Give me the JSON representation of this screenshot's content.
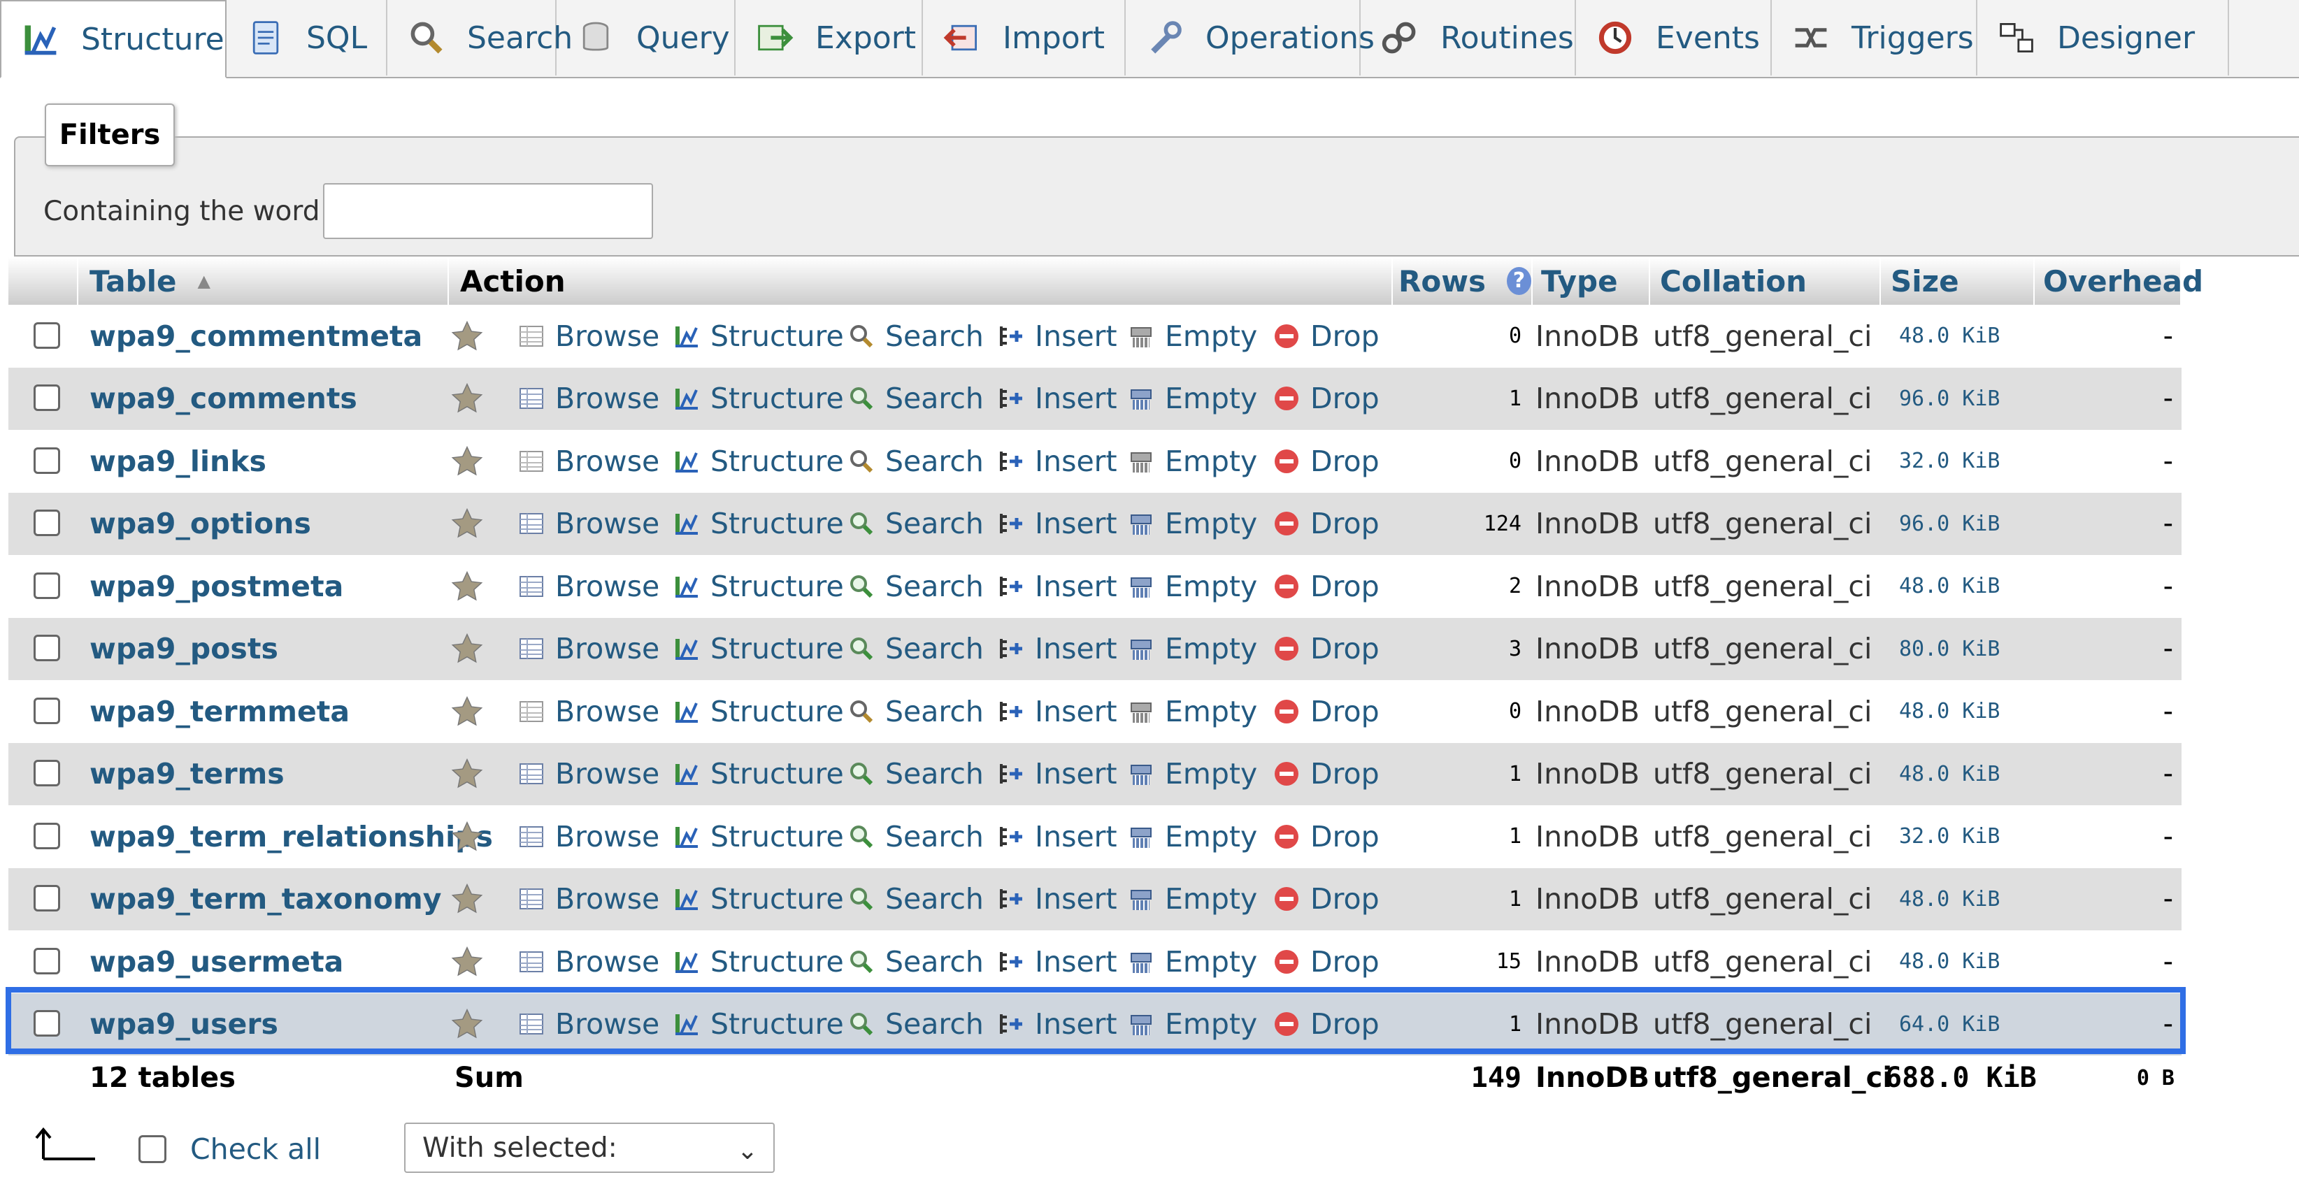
{
  "tabs": [
    {
      "label": "Structure",
      "icon": "structure-icon",
      "active": true
    },
    {
      "label": "SQL",
      "icon": "sql-icon"
    },
    {
      "label": "Search",
      "icon": "search-icon"
    },
    {
      "label": "Query",
      "icon": "query-icon"
    },
    {
      "label": "Export",
      "icon": "export-icon"
    },
    {
      "label": "Import",
      "icon": "import-icon"
    },
    {
      "label": "Operations",
      "icon": "wrench-icon"
    },
    {
      "label": "Routines",
      "icon": "routines-icon"
    },
    {
      "label": "Events",
      "icon": "clock-icon"
    },
    {
      "label": "Triggers",
      "icon": "triggers-icon"
    },
    {
      "label": "Designer",
      "icon": "designer-icon"
    }
  ],
  "filters": {
    "legend": "Filters",
    "label": "Containing the word:",
    "value": "",
    "placeholder": ""
  },
  "table": {
    "headers": {
      "table": "Table",
      "action": "Action",
      "rows": "Rows",
      "type": "Type",
      "collation": "Collation",
      "size": "Size",
      "overhead": "Overhead"
    },
    "sort_indicator": "▲",
    "actions": {
      "browse": "Browse",
      "structure": "Structure",
      "search": "Search",
      "insert": "Insert",
      "empty": "Empty",
      "drop": "Drop"
    },
    "rows": [
      {
        "name": "wpa9_commentmeta",
        "rows": "0",
        "type": "InnoDB",
        "collation": "utf8_general_ci",
        "size": "48.0 KiB",
        "overhead": "-"
      },
      {
        "name": "wpa9_comments",
        "rows": "1",
        "type": "InnoDB",
        "collation": "utf8_general_ci",
        "size": "96.0 KiB",
        "overhead": "-"
      },
      {
        "name": "wpa9_links",
        "rows": "0",
        "type": "InnoDB",
        "collation": "utf8_general_ci",
        "size": "32.0 KiB",
        "overhead": "-"
      },
      {
        "name": "wpa9_options",
        "rows": "124",
        "type": "InnoDB",
        "collation": "utf8_general_ci",
        "size": "96.0 KiB",
        "overhead": "-"
      },
      {
        "name": "wpa9_postmeta",
        "rows": "2",
        "type": "InnoDB",
        "collation": "utf8_general_ci",
        "size": "48.0 KiB",
        "overhead": "-"
      },
      {
        "name": "wpa9_posts",
        "rows": "3",
        "type": "InnoDB",
        "collation": "utf8_general_ci",
        "size": "80.0 KiB",
        "overhead": "-"
      },
      {
        "name": "wpa9_termmeta",
        "rows": "0",
        "type": "InnoDB",
        "collation": "utf8_general_ci",
        "size": "48.0 KiB",
        "overhead": "-"
      },
      {
        "name": "wpa9_terms",
        "rows": "1",
        "type": "InnoDB",
        "collation": "utf8_general_ci",
        "size": "48.0 KiB",
        "overhead": "-"
      },
      {
        "name": "wpa9_term_relationships",
        "rows": "1",
        "type": "InnoDB",
        "collation": "utf8_general_ci",
        "size": "32.0 KiB",
        "overhead": "-"
      },
      {
        "name": "wpa9_term_taxonomy",
        "rows": "1",
        "type": "InnoDB",
        "collation": "utf8_general_ci",
        "size": "48.0 KiB",
        "overhead": "-"
      },
      {
        "name": "wpa9_usermeta",
        "rows": "15",
        "type": "InnoDB",
        "collation": "utf8_general_ci",
        "size": "48.0 KiB",
        "overhead": "-"
      },
      {
        "name": "wpa9_users",
        "rows": "1",
        "type": "InnoDB",
        "collation": "utf8_general_ci",
        "size": "64.0 KiB",
        "overhead": "-",
        "selected": true
      }
    ],
    "summary": {
      "tables": "12 tables",
      "label": "Sum",
      "rows": "149",
      "type": "InnoDB",
      "collation": "utf8_general_ci",
      "size": "688.0 KiB",
      "overhead": "0 B"
    }
  },
  "footer": {
    "check_all": "Check all",
    "with_selected": "With selected:"
  },
  "colors": {
    "link": "#235a81",
    "highlight": "#2f6ee5"
  }
}
